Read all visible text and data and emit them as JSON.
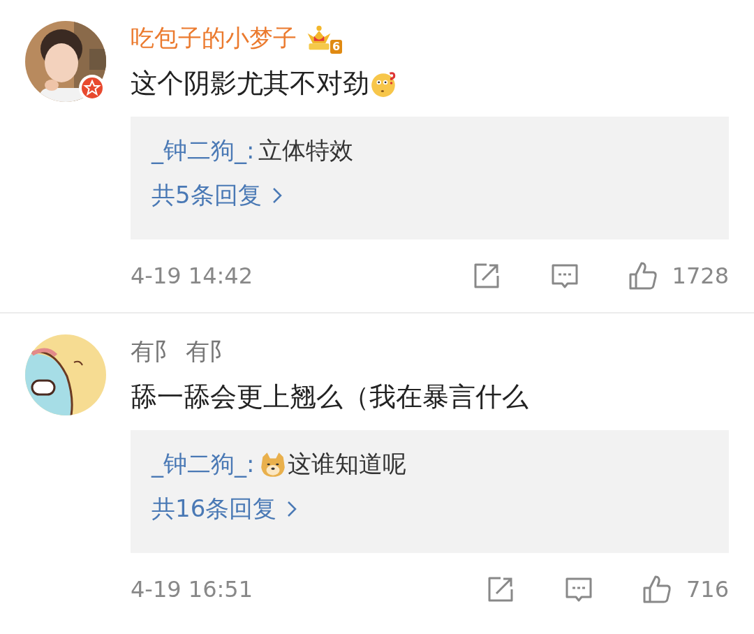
{
  "comments": [
    {
      "author": "吃包子的小梦子",
      "vip": true,
      "badge": "6",
      "verified": true,
      "content": [
        {
          "kind": "text",
          "text": "这个阴影尤其不对劲"
        },
        {
          "kind": "emoji"
        }
      ],
      "reply": {
        "author": "_钟二狗_:",
        "content": [
          {
            "kind": "text",
            "text": "立体特效"
          }
        ],
        "more": "共5条回复"
      },
      "time": "4-19 14:42",
      "likes": "1728"
    },
    {
      "author": "有阝 有阝",
      "vip": false,
      "verified": false,
      "content": [
        {
          "kind": "text",
          "text": "舔一舔会更上翘么（我在暴言什么"
        }
      ],
      "reply": {
        "author": "_钟二狗_:",
        "content": [
          {
            "kind": "emoji"
          },
          {
            "kind": "text",
            "text": "这谁知道呢"
          }
        ],
        "more": "共16条回复"
      },
      "time": "4-19 16:51",
      "likes": "716"
    }
  ]
}
